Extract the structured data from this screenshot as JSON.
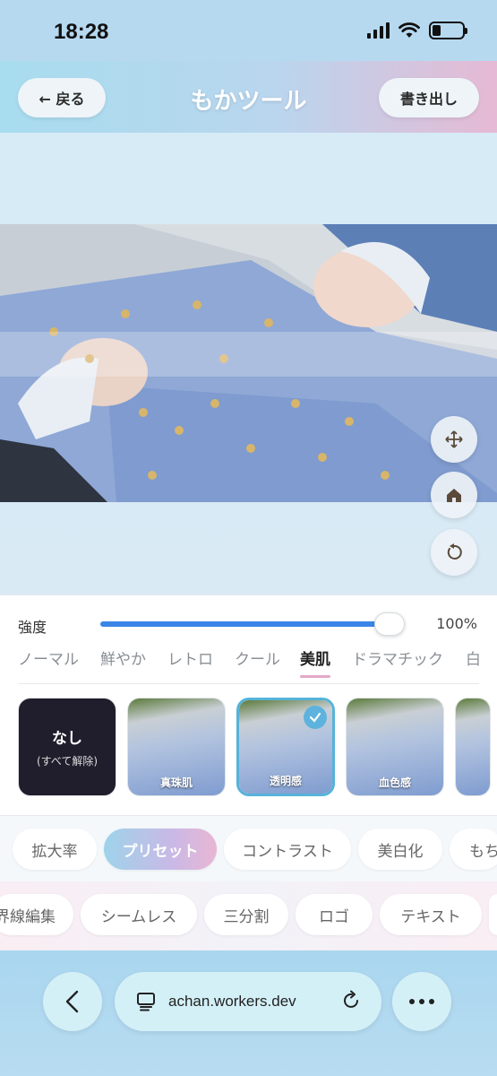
{
  "status": {
    "time": "18:28"
  },
  "header": {
    "back_label": "← 戻る",
    "title": "もかツール",
    "export_label": "書き出し"
  },
  "slider": {
    "label": "強度",
    "value_text": "100%",
    "value": 1.0
  },
  "categories": [
    {
      "label": "ノーマル",
      "active": false
    },
    {
      "label": "鮮やか",
      "active": false
    },
    {
      "label": "レトロ",
      "active": false
    },
    {
      "label": "クール",
      "active": false
    },
    {
      "label": "美肌",
      "active": true
    },
    {
      "label": "ドラマチック",
      "active": false
    },
    {
      "label": "白",
      "active": false
    }
  ],
  "presets": {
    "none": {
      "title": "なし",
      "subtitle": "(すべて解除)"
    },
    "items": [
      {
        "label": "真珠肌",
        "selected": false
      },
      {
        "label": "透明感",
        "selected": true
      },
      {
        "label": "血色感",
        "selected": false
      }
    ]
  },
  "tools_row1": [
    "拡大率",
    "プリセット",
    "コントラスト",
    "美白化",
    "もち"
  ],
  "tools_row1_active": "プリセット",
  "tools_row2": [
    "界線編集",
    "シームレス",
    "三分割",
    "ロゴ",
    "テキスト"
  ],
  "browser": {
    "url": "achan.workers.dev"
  },
  "colors": {
    "accent": "#3a86e8",
    "selected": "#56b3d9",
    "active_tab_underline": "#e3a9c9"
  }
}
